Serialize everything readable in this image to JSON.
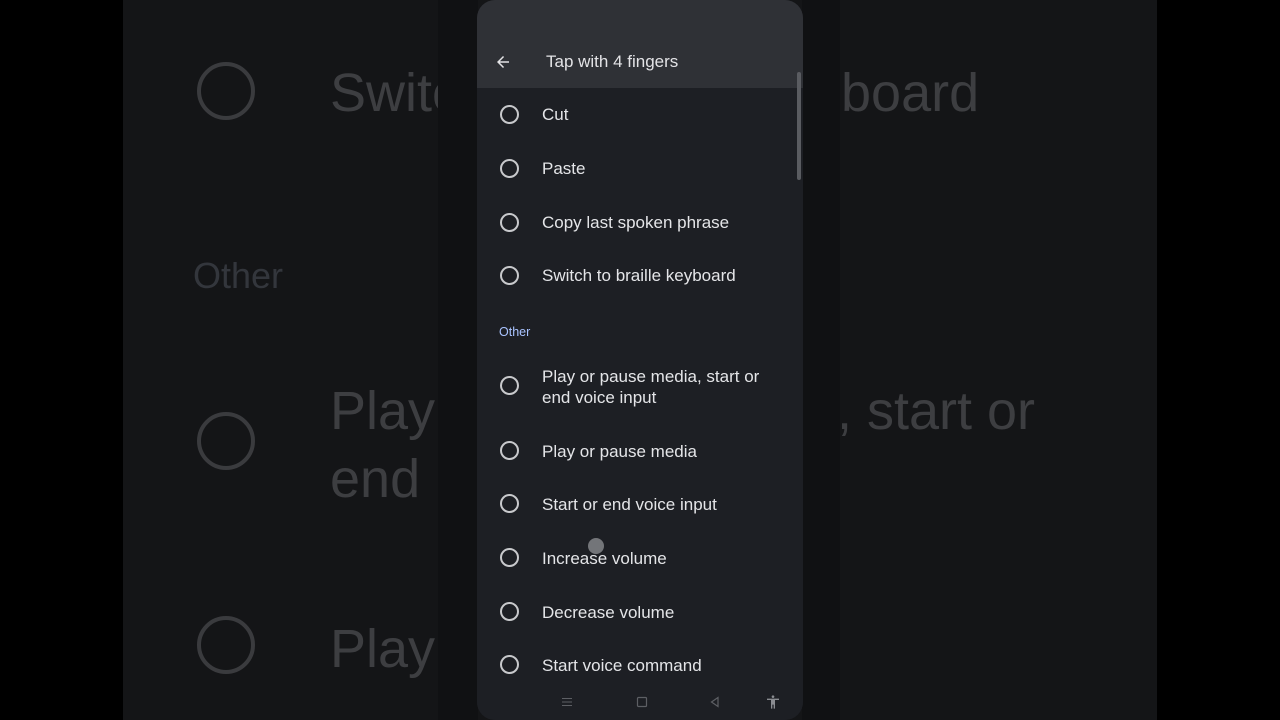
{
  "header": {
    "title": "Tap with 4 fingers",
    "back_icon": "arrow-left-icon"
  },
  "background_echo": {
    "item1": "Switc",
    "item1_right": "board",
    "section": "Other",
    "item2_line1": "Play",
    "item2_line1_right": ", start or",
    "item2_line2": "end",
    "item3": "Play"
  },
  "options_top": [
    {
      "label": "Cut"
    },
    {
      "label": "Paste"
    },
    {
      "label": "Copy last spoken phrase"
    },
    {
      "label": "Switch to braille keyboard"
    }
  ],
  "section_other": "Other",
  "options_other": [
    {
      "label": "Play or pause media, start or end voice input"
    },
    {
      "label": "Play or pause media"
    },
    {
      "label": "Start or end voice input"
    },
    {
      "label": "Increase volume"
    },
    {
      "label": "Decrease volume"
    },
    {
      "label": "Start voice command"
    }
  ],
  "navbar": {
    "items": [
      "menu-icon",
      "square-home-icon",
      "triangle-back-icon",
      "accessibility-icon"
    ]
  },
  "colors": {
    "accent": "#a9c3ff",
    "surface": "#1d1f24",
    "appbar": "#2f3136"
  }
}
